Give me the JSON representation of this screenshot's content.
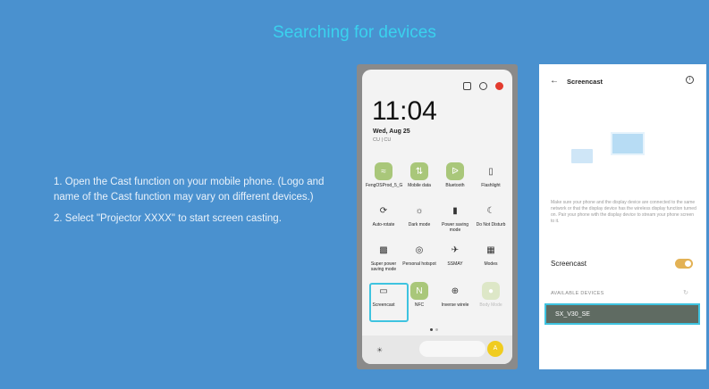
{
  "title": "Searching for devices",
  "instructions": {
    "step1": "1. Open the Cast function on your mobile phone. (Logo and name of the Cast function may vary on different devices.)",
    "step2": "2. Select \"Projector XXXX\" to start screen casting."
  },
  "phone1": {
    "time": "11:04",
    "date": "Wed, Aug 25",
    "sub": "CU | CU",
    "tiles": [
      {
        "label": "FengOSProd_5_G",
        "sub": "",
        "icon": "wifi-icon",
        "state": "on"
      },
      {
        "label": "Mobile data",
        "sub": "",
        "icon": "mobile-data-icon",
        "state": "on"
      },
      {
        "label": "Bluetooth",
        "sub": "",
        "icon": "bluetooth-icon",
        "state": "on"
      },
      {
        "label": "Flashlight",
        "sub": "",
        "icon": "flashlight-icon",
        "state": "off"
      },
      {
        "label": "Auto-rotate",
        "sub": "",
        "icon": "rotate-icon",
        "state": "off"
      },
      {
        "label": "Dark mode",
        "sub": "",
        "icon": "dark-mode-icon",
        "state": "off"
      },
      {
        "label": "Power saving mode",
        "sub": "",
        "icon": "battery-icon",
        "state": "off"
      },
      {
        "label": "Do Not Disturb",
        "sub": "",
        "icon": "moon-icon",
        "state": "off"
      },
      {
        "label": "Super power saving mode",
        "sub": "",
        "icon": "super-power-icon",
        "state": "off"
      },
      {
        "label": "Personal hotspot",
        "sub": "",
        "icon": "hotspot-icon",
        "state": "off"
      },
      {
        "label": "SSMAY",
        "sub": "",
        "icon": "airplane-icon",
        "state": "off"
      },
      {
        "label": "Modes",
        "sub": "",
        "icon": "modes-icon",
        "state": "off"
      },
      {
        "label": "Screencast",
        "sub": "",
        "icon": "screencast-icon",
        "state": "off"
      },
      {
        "label": "NFC",
        "sub": "",
        "icon": "nfc-icon",
        "state": "on"
      },
      {
        "label": "Inverse wirele",
        "sub": "",
        "icon": "inverse-wireless-icon",
        "state": "off"
      },
      {
        "label": "Body Mode",
        "sub": "",
        "icon": "body-mode-icon",
        "state": "pale"
      }
    ]
  },
  "phone2": {
    "header": "Screencast",
    "description": "Make sure your phone and the display device are connected to the same network or that the display device has the wireless display function turned on. Pair your phone with the display device to stream your phone screen to it.",
    "screencast_label": "Screencast",
    "available_label": "AVAILABLE DEVICES",
    "device_name": "SX_V30_SE"
  },
  "colors": {
    "background": "#4a91cf",
    "title": "#3ad2ee",
    "highlight": "#3ec3e0",
    "tile_on": "#a9c77a",
    "toggle": "#e3b255"
  }
}
